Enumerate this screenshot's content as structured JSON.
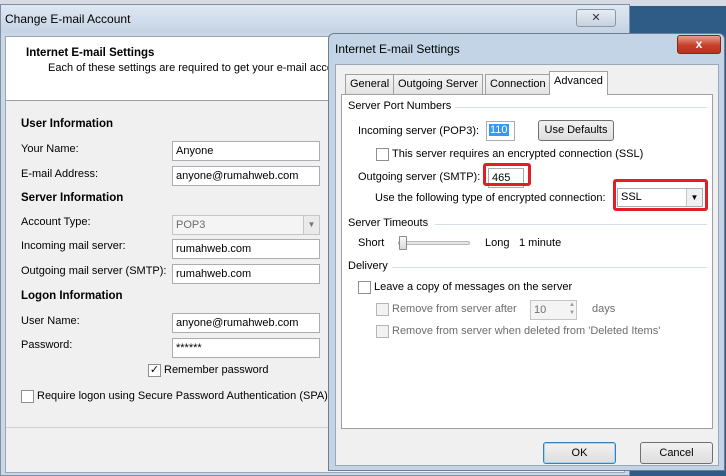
{
  "back": {
    "title": "Change E-mail Account",
    "header_title": "Internet E-mail Settings",
    "header_subtitle": "Each of these settings are required to get your e-mail acco",
    "user_info": "User Information",
    "your_name_label": "Your Name:",
    "your_name_value": "Anyone",
    "email_label": "E-mail Address:",
    "email_value": "anyone@rumahweb.com",
    "server_info": "Server Information",
    "account_type_label": "Account Type:",
    "account_type_value": "POP3",
    "incoming_label": "Incoming mail server:",
    "incoming_value": "rumahweb.com",
    "outgoing_label": "Outgoing mail server (SMTP):",
    "outgoing_value": "rumahweb.com",
    "logon_info": "Logon Information",
    "username_label": "User Name:",
    "username_value": "anyone@rumahweb.com",
    "password_label": "Password:",
    "password_value": "******",
    "remember_label": "Remember password",
    "remember_checked": "✓",
    "spa_label": "Require logon using Secure Password Authentication (SPA)"
  },
  "dialog": {
    "title": "Internet E-mail Settings",
    "close": "x",
    "tabs": [
      "General",
      "Outgoing Server",
      "Connection",
      "Advanced"
    ],
    "ports_group": "Server Port Numbers",
    "incoming_label": "Incoming server (POP3):",
    "incoming_port": "110",
    "use_defaults": "Use Defaults",
    "ssl_incoming_label": "This server requires an encrypted connection (SSL)",
    "outgoing_label": "Outgoing server (SMTP):",
    "outgoing_port": "465",
    "encryption_label": "Use the following type of encrypted connection:",
    "encryption_value": "SSL",
    "timeouts_group": "Server Timeouts",
    "short_label": "Short",
    "long_label": "Long",
    "timeout_value": "1 minute",
    "timeout_level": 0.0,
    "delivery_group": "Delivery",
    "leave_copy_label": "Leave a copy of messages on the server",
    "remove_after_label": "Remove from server after",
    "remove_after_value": "10",
    "days_label": "days",
    "remove_deleted_label": "Remove from server when deleted from 'Deleted Items'",
    "ok": "OK",
    "cancel": "Cancel"
  },
  "highlight_color": "#e01e24"
}
